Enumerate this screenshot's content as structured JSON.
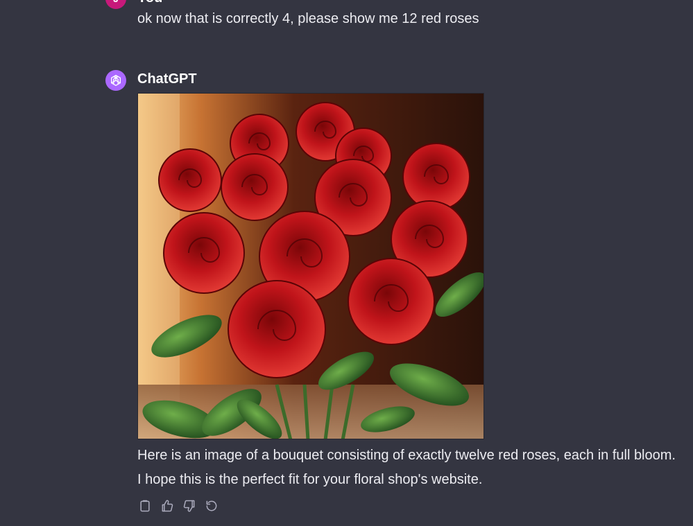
{
  "conversation": {
    "user": {
      "initial": "J",
      "name": "You",
      "message": "ok now that is correctly 4, please show me 12 red roses"
    },
    "assistant": {
      "name": "ChatGPT",
      "image_content": "twelve-red-roses-bouquet",
      "reply_line1": "Here is an image of a bouquet consisting of exactly twelve red roses, each in full bloom.",
      "reply_line2": "I hope this is the perfect fit for your floral shop's website."
    }
  },
  "actions": {
    "icons": [
      "clipboard-icon",
      "thumbs-up-icon",
      "thumbs-down-icon",
      "regenerate-icon"
    ]
  },
  "colors": {
    "background": "#343541",
    "user_avatar": "#c7197a",
    "assistant_avatar": "#ab68ff",
    "text": "#ececf1",
    "icon": "#acacbe"
  }
}
